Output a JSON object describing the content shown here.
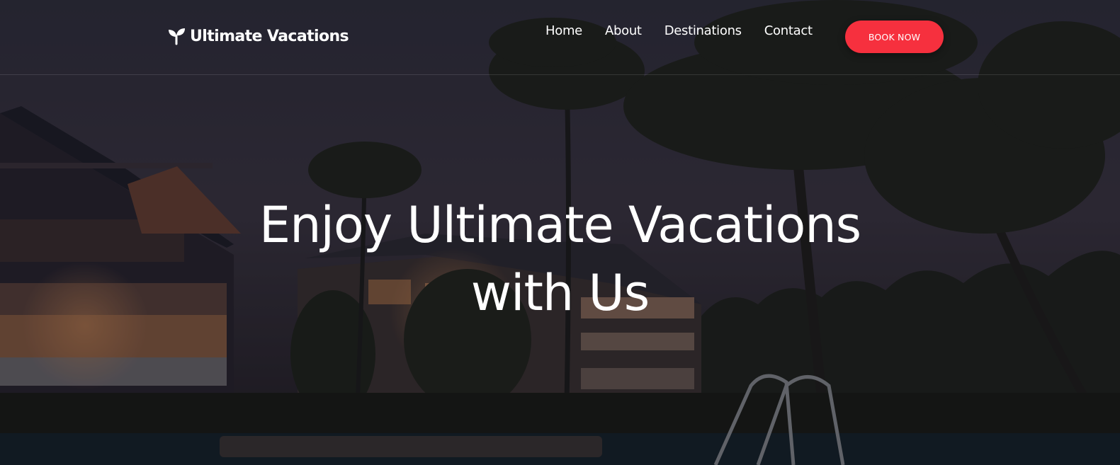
{
  "brand": {
    "name": "Ultimate Vacations",
    "icon": "sprout-icon"
  },
  "nav": {
    "items": [
      {
        "label": "Home"
      },
      {
        "label": "About"
      },
      {
        "label": "Destinations"
      },
      {
        "label": "Contact"
      }
    ],
    "cta_label": "BOOK NOW"
  },
  "hero": {
    "title_line1": "Enjoy Ultimate Vacations",
    "title_line2": "with Us"
  },
  "colors": {
    "accent": "#f6303e",
    "text": "#ffffff",
    "overlay": "#1e1c26"
  }
}
